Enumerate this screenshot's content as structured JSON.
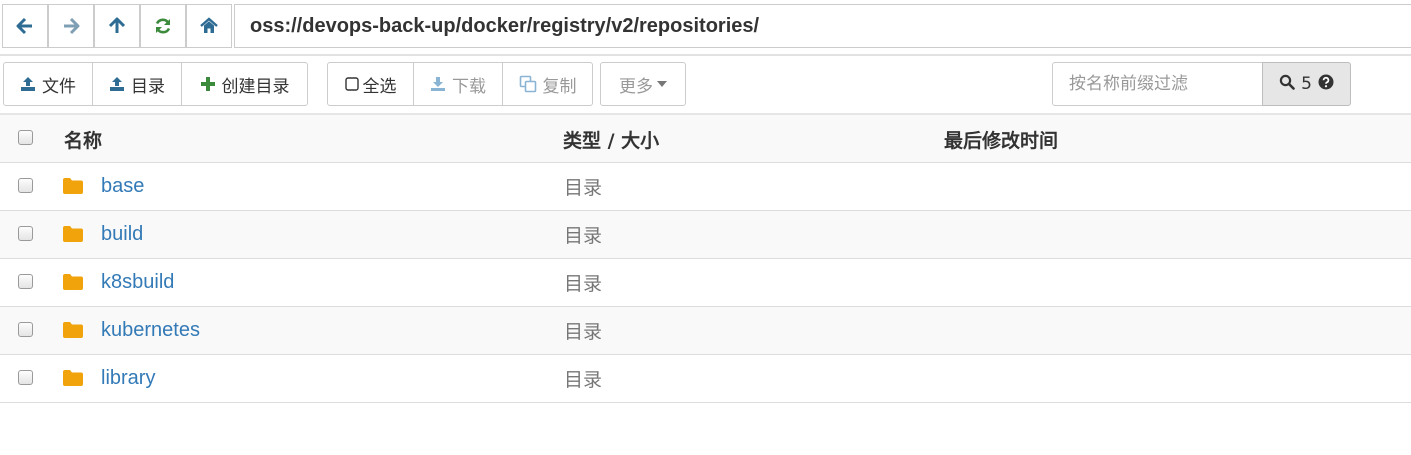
{
  "address_bar": {
    "path": "oss://devops-back-up/docker/registry/v2/repositories/",
    "buttons": [
      {
        "name": "back",
        "icon": "arrow-left-icon",
        "color": "#2e6c94"
      },
      {
        "name": "forward",
        "icon": "arrow-right-icon",
        "color": "#7f9fb5"
      },
      {
        "name": "up",
        "icon": "arrow-up-icon",
        "color": "#2e6c94"
      },
      {
        "name": "refresh",
        "icon": "refresh-icon",
        "color": "#3c8a3c"
      },
      {
        "name": "home",
        "icon": "home-icon",
        "color": "#2e6c94"
      }
    ]
  },
  "toolbar": {
    "upload_file_label": "文件",
    "upload_dir_label": "目录",
    "create_dir_label": "创建目录",
    "select_all_label": "全选",
    "download_label": "下载",
    "copy_label": "复制",
    "more_label": "更多",
    "filter_placeholder": "按名称前缀过滤",
    "result_count": "5"
  },
  "table": {
    "headers": {
      "name": "名称",
      "type_size": "类型 / 大小",
      "modified": "最后修改时间"
    },
    "rows": [
      {
        "name": "base",
        "type": "目录",
        "modified": ""
      },
      {
        "name": "build",
        "type": "目录",
        "modified": ""
      },
      {
        "name": "k8sbuild",
        "type": "目录",
        "modified": ""
      },
      {
        "name": "kubernetes",
        "type": "目录",
        "modified": ""
      },
      {
        "name": "library",
        "type": "目录",
        "modified": ""
      }
    ]
  },
  "colors": {
    "link": "#337ab7",
    "folder": "#f0a30a",
    "upload_icon": "#2e6c94",
    "create_icon": "#3c8a3c"
  }
}
